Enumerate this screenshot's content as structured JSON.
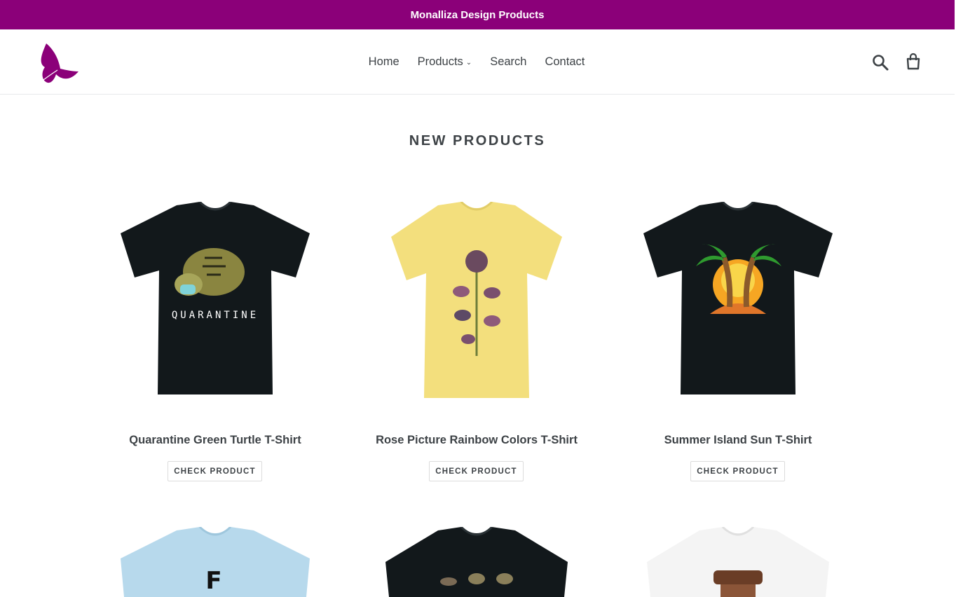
{
  "announcement": "Monalliza Design Products",
  "nav": {
    "items": [
      {
        "label": "Home"
      },
      {
        "label": "Products"
      },
      {
        "label": "Search"
      },
      {
        "label": "Contact"
      }
    ]
  },
  "section": {
    "title": "NEW PRODUCTS"
  },
  "products": [
    {
      "title": "Quarantine Green Turtle T-Shirt",
      "button": "CHECK PRODUCT",
      "shirt_color": "#12181b",
      "graphic_text": "QUARANTINE"
    },
    {
      "title": "Rose Picture Rainbow Colors T-Shirt",
      "button": "CHECK PRODUCT",
      "shirt_color": "#f3df7d"
    },
    {
      "title": "Summer Island Sun T-Shirt",
      "button": "CHECK PRODUCT",
      "shirt_color": "#12181b"
    }
  ],
  "products_row2": [
    {
      "shirt_color": "#b7d9ec",
      "graphic_text": "F"
    },
    {
      "shirt_color": "#12181b"
    },
    {
      "shirt_color": "#f4f4f4"
    }
  ],
  "colors": {
    "brand": "#8b0079"
  }
}
